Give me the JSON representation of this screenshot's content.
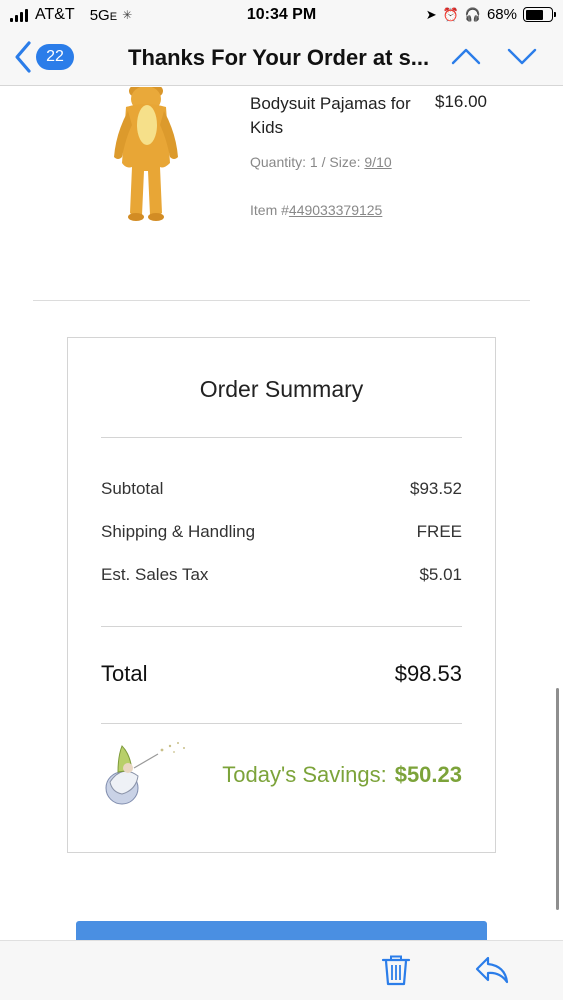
{
  "status_bar": {
    "carrier": "AT&T",
    "network": "5G",
    "network_suffix": "E",
    "time": "10:34 PM",
    "battery": "68%",
    "battery_level": 0.68
  },
  "nav": {
    "unread_count": "22",
    "title": "Thanks For Your Order at s..."
  },
  "product": {
    "name": "Bodysuit Pajamas for Kids",
    "price": "$16.00",
    "quantity_label": "Quantity: 1 / Size: ",
    "size": "9/10",
    "item_label": "Item #",
    "item_number": "449033379125"
  },
  "order_summary": {
    "title": "Order Summary",
    "rows": [
      {
        "label": "Subtotal",
        "value": "$93.52"
      },
      {
        "label": "Shipping & Handling",
        "value": "FREE"
      },
      {
        "label": "Est. Sales Tax",
        "value": "$5.01"
      }
    ],
    "total_label": "Total",
    "total_value": "$98.53",
    "savings_label": "Today's Savings:",
    "savings_value": "$50.23"
  },
  "colors": {
    "accent": "#2b7de9",
    "savings": "#7ca33a",
    "button": "#4a8fe2"
  },
  "icons": {
    "back": "chevron-left-icon",
    "previous": "chevron-up-icon",
    "next": "chevron-down-icon",
    "trash": "trash-icon",
    "reply": "reply-icon",
    "savings_art": "fairy-godmother-icon"
  }
}
